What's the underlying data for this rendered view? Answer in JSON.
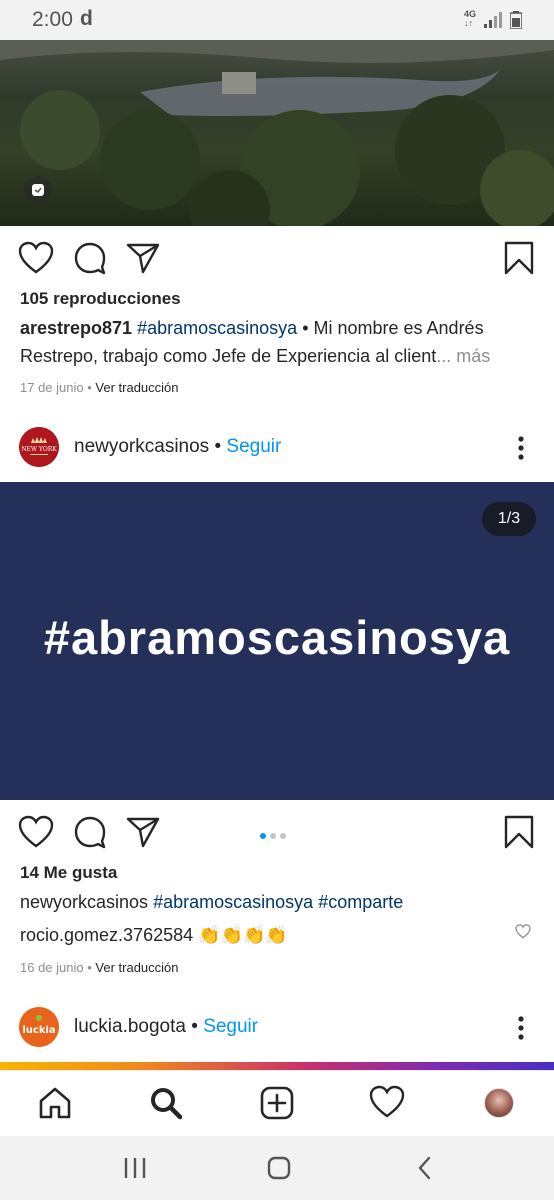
{
  "status_bar": {
    "time": "2:00",
    "notification_letter": "d",
    "network": "4G"
  },
  "post1": {
    "video_icon": "reels-icon",
    "views": "105 reproducciones",
    "caption_user": "arestrepo871",
    "caption_hashtag": "#abramoscasinosya",
    "caption_text_1": " • Mi nombre es Andrés",
    "caption_text_2": "Restrepo, trabajo como Jefe de Experiencia al client",
    "more": "... más",
    "date": "17 de junio",
    "translate": "Ver traducción"
  },
  "post2": {
    "username": "newyorkcasinos",
    "separator": " • ",
    "follow": "Seguir",
    "avatar_text": "NEW YORK",
    "image_text": "#abramoscasinosya",
    "counter": "1/3",
    "likes": "14 Me gusta",
    "caption_user": "newyorkcasinos",
    "caption_hashtag_1": "#abramoscasinosya",
    "caption_hashtag_2": "#comparte",
    "comment_user": "rocio.gomez.3762584",
    "comment_emoji": "👏👏👏👏",
    "date": "16 de junio",
    "translate": "Ver traducción"
  },
  "post3": {
    "username": "luckia.bogota",
    "separator": " • ",
    "follow": "Seguir",
    "avatar_text": "luckia"
  },
  "colors": {
    "follow_blue": "#0095f6",
    "hashtag_blue": "#00376b",
    "carousel_bg": "#24305a",
    "newyork_red": "#b0161d",
    "luckia_orange": "#e8641c"
  }
}
